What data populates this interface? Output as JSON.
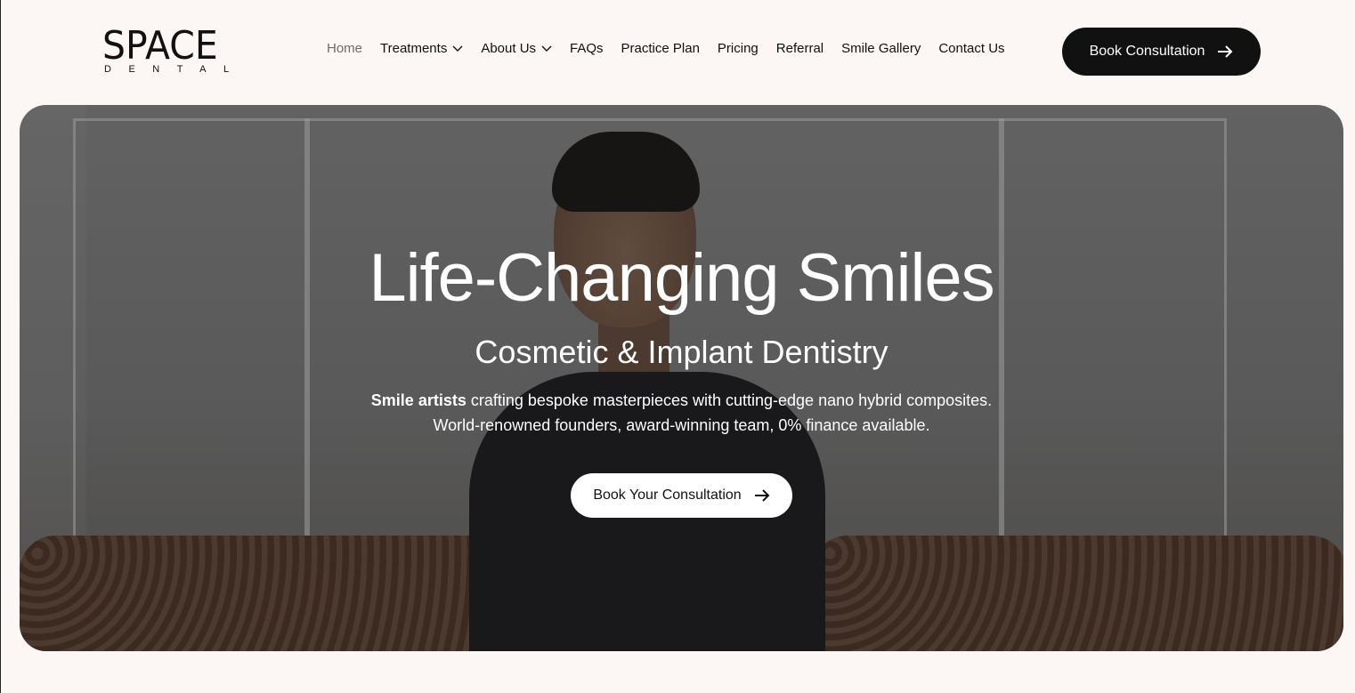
{
  "brand": {
    "logo_main": "SPACE",
    "logo_sub": "DENTAL"
  },
  "nav": {
    "items": [
      {
        "label": "Home",
        "active": true,
        "dropdown": false
      },
      {
        "label": "Treatments",
        "active": false,
        "dropdown": true
      },
      {
        "label": "About Us",
        "active": false,
        "dropdown": true
      },
      {
        "label": "FAQs",
        "active": false,
        "dropdown": false
      },
      {
        "label": "Practice Plan",
        "active": false,
        "dropdown": false
      },
      {
        "label": "Pricing",
        "active": false,
        "dropdown": false
      },
      {
        "label": "Referral",
        "active": false,
        "dropdown": false
      },
      {
        "label": "Smile Gallery",
        "active": false,
        "dropdown": false
      },
      {
        "label": "Contact Us",
        "active": false,
        "dropdown": false
      }
    ],
    "cta_label": "Book Consultation"
  },
  "hero": {
    "title": "Life-Changing Smiles",
    "subtitle": "Cosmetic & Implant Dentistry",
    "desc_bold": "Smile artists",
    "desc_line1_rest": " crafting bespoke masterpieces with cutting-edge nano hybrid composites.",
    "desc_line2": "World-renowned founders, award-winning team, 0% finance available.",
    "cta_label": "Book Your Consultation"
  },
  "colors": {
    "background": "#fcf6f4",
    "dark": "#111111",
    "nav_active": "#6d6d6d"
  },
  "icons": {
    "cta_arrow": "arrow-right-icon",
    "dropdown": "chevron-down-icon"
  }
}
